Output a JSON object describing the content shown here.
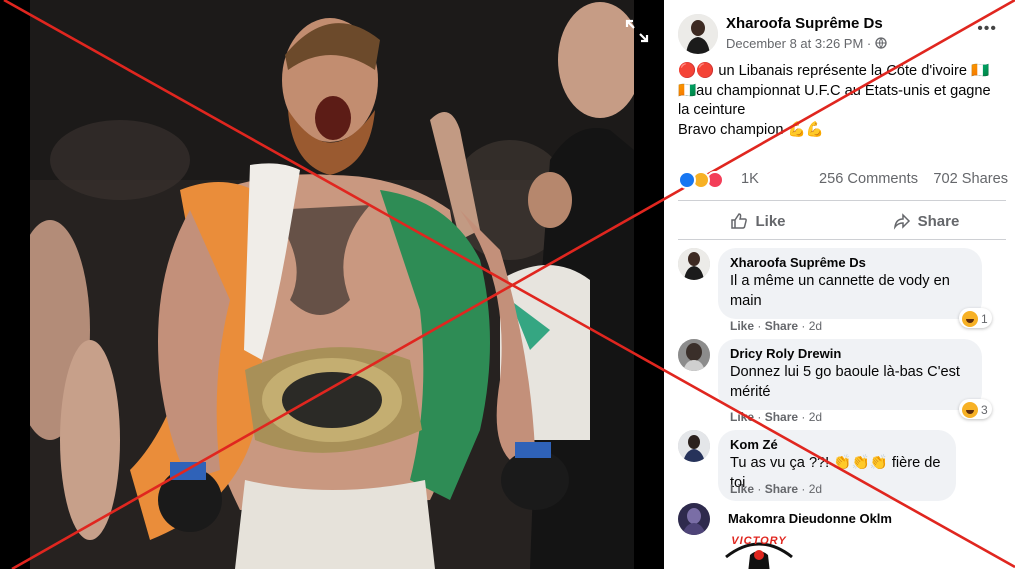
{
  "post": {
    "author": "Xharoofa Suprême Ds",
    "date": "December 8 at 3:26 PM",
    "date_separator": " · ",
    "privacy_icon": "globe-icon",
    "text_line1": "🔴🔴 un Libanais représente la Côte d'ivoire 🇨🇮",
    "text_line2": "🇨🇮au championnat U.F.C au Etats-unis et gagne",
    "text_line3": "la ceinture",
    "text_line4": "Bravo champion 💪💪",
    "reaction_count": "1K",
    "comments_count": "256 Comments",
    "shares_count": "702 Shares",
    "like_label": "Like",
    "share_label": "Share",
    "more_label": "•••"
  },
  "comments": [
    {
      "name": "Xharoofa Suprême Ds",
      "text_line1": "Il a même un cannette de vody en",
      "text_line2": "main",
      "like": "Like",
      "share": "Share",
      "age": "2d",
      "reaction_count": "1"
    },
    {
      "name": "Dricy Roly Drewin",
      "text_line1": "Donnez lui 5 go baoule là-bas C'est",
      "text_line2": "mérité",
      "like": "Like",
      "share": "Share",
      "age": "2d",
      "reaction_count": "3"
    },
    {
      "name": "Kom Zé",
      "text_line1": "Tu as vu ça ??! 👏👏👏 fière de toi",
      "like": "Like",
      "share": "Share",
      "age": "2d"
    },
    {
      "name": "Makomra Dieudonne Oklm",
      "image_text": "VICTORY"
    }
  ],
  "separator": " · ",
  "colors": {
    "cross_red": "#e0261f",
    "secondary_text": "#65676b",
    "bubble_bg": "#f0f2f5",
    "like_blue": "#1877f2"
  }
}
